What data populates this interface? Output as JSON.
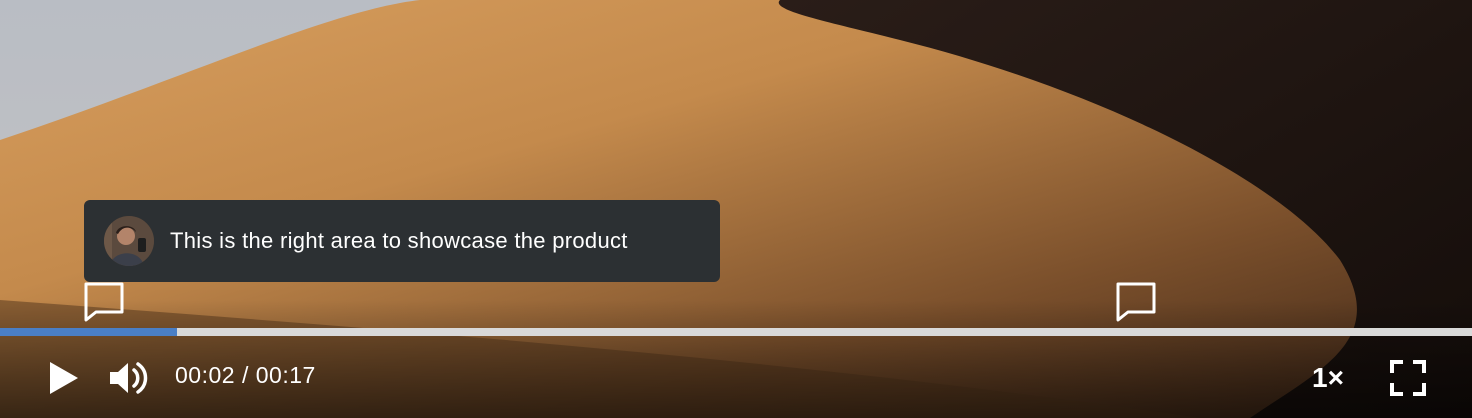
{
  "player": {
    "comment": {
      "text": "This is the right area to showcase the product",
      "avatar_icon": "user-avatar"
    },
    "markers": [
      {
        "icon": "comment-marker-icon"
      },
      {
        "icon": "comment-marker-icon"
      }
    ],
    "timeline": {
      "played_fraction": 0.12,
      "played_color": "#4a7fc6",
      "track_color": "#d9d9d9"
    },
    "controls": {
      "play_icon": "play-icon",
      "volume_icon": "volume-icon",
      "current_time": "00:02",
      "duration": "00:17",
      "time_separator": " / ",
      "speed": "1×",
      "fullscreen_icon": "fullscreen-icon"
    }
  }
}
